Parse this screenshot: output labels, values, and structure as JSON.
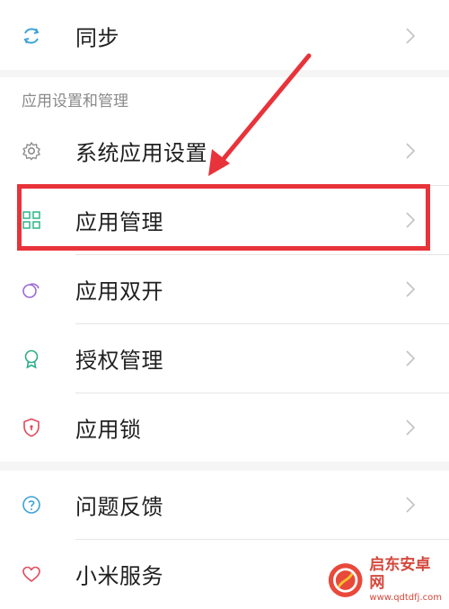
{
  "sync": {
    "label": "同步",
    "icon": "sync-icon"
  },
  "section": {
    "title": "应用设置和管理"
  },
  "items": [
    {
      "label": "系统应用设置",
      "icon": "gear-icon"
    },
    {
      "label": "应用管理",
      "icon": "grid-icon"
    },
    {
      "label": "应用双开",
      "icon": "dual-circle-icon"
    },
    {
      "label": "授权管理",
      "icon": "badge-icon"
    },
    {
      "label": "应用锁",
      "icon": "shield-icon"
    }
  ],
  "more": [
    {
      "label": "问题反馈",
      "icon": "question-icon"
    },
    {
      "label": "小米服务",
      "icon": "heart-icon"
    }
  ],
  "watermark": {
    "title": "启东安卓网",
    "url": "www.qdtdfj.com"
  },
  "colors": {
    "highlight": "#e8333a",
    "chevron": "#c2c2c2",
    "section_bg": "#f5f5f5",
    "sync_icon": "#3da3d8",
    "gear_icon": "#8c8c8c",
    "grid_icon": "#2db58a",
    "dual_icon": "#9a6ad8",
    "badge_icon": "#2cae87",
    "shield_icon": "#e2485a",
    "question_icon": "#3da3d8",
    "heart_icon": "#e2485a"
  }
}
